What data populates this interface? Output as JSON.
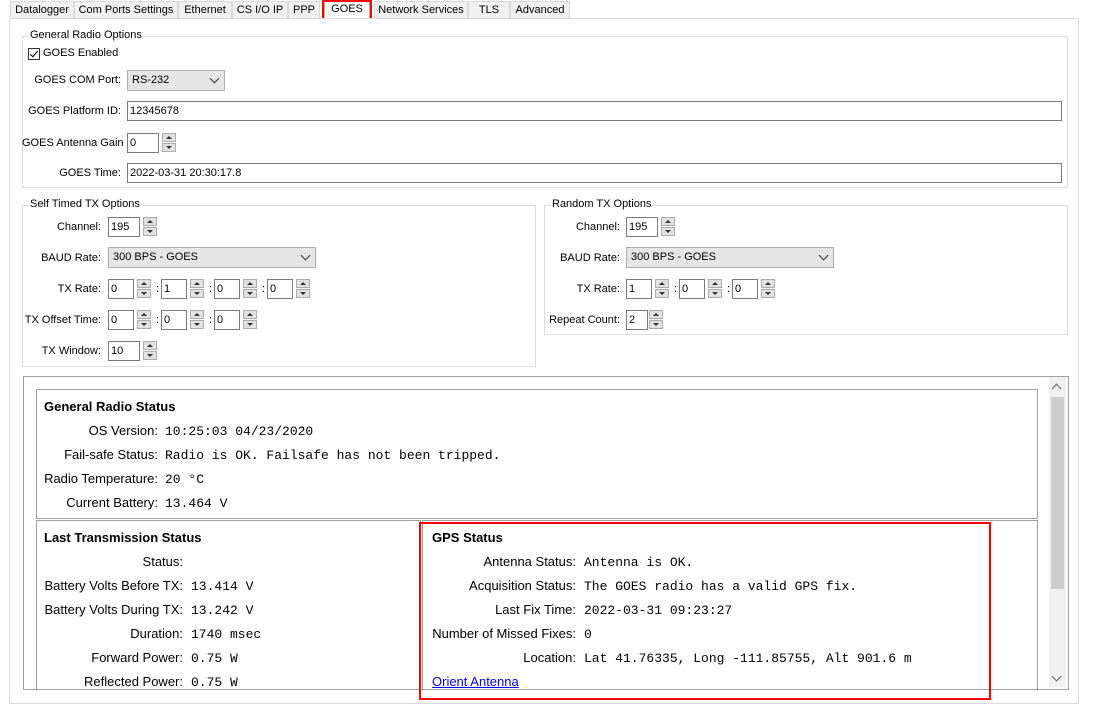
{
  "tabs": [
    {
      "label": "Datalogger"
    },
    {
      "label": "Com Ports Settings"
    },
    {
      "label": "Ethernet"
    },
    {
      "label": "CS I/O IP"
    },
    {
      "label": "PPP"
    },
    {
      "label": "GOES"
    },
    {
      "label": "Network Services"
    },
    {
      "label": "TLS"
    },
    {
      "label": "Advanced"
    }
  ],
  "general_radio_options": {
    "title": "General Radio Options",
    "goes_enabled_label": "GOES Enabled",
    "goes_enabled": true,
    "com_port_label": "GOES COM Port:",
    "com_port_value": "RS-232",
    "platform_id_label": "GOES Platform ID:",
    "platform_id_value": "12345678",
    "antenna_gain_label": "GOES Antenna Gain",
    "antenna_gain_value": "0",
    "time_label": "GOES Time:",
    "time_value": "2022-03-31 20:30:17.8"
  },
  "self_timed": {
    "title": "Self Timed TX Options",
    "channel_label": "Channel:",
    "channel_value": "195",
    "baud_label": "BAUD Rate:",
    "baud_value": "300 BPS - GOES",
    "tx_rate_label": "TX Rate:",
    "tx_rate_values": [
      "0",
      "1",
      "0",
      "0"
    ],
    "tx_offset_label": "TX Offset Time:",
    "tx_offset_values": [
      "0",
      "0",
      "0"
    ],
    "tx_window_label": "TX Window:",
    "tx_window_value": "10"
  },
  "random_tx": {
    "title": "Random TX Options",
    "channel_label": "Channel:",
    "channel_value": "195",
    "baud_label": "BAUD Rate:",
    "baud_value": "300 BPS - GOES",
    "tx_rate_label": "TX Rate:",
    "tx_rate_values": [
      "1",
      "0",
      "0"
    ],
    "repeat_label": "Repeat Count:",
    "repeat_value": "2"
  },
  "colon": ":",
  "general_status": {
    "title": "General Radio Status",
    "rows": [
      {
        "label": "OS Version:",
        "value": "10:25:03 04/23/2020"
      },
      {
        "label": "Fail-safe Status:",
        "value": "Radio is OK. Failsafe has not been tripped."
      },
      {
        "label": "Radio Temperature:",
        "value": "20 °C"
      },
      {
        "label": "Current Battery:",
        "value": "13.464 V"
      }
    ]
  },
  "last_tx_status": {
    "title": "Last Transmission Status",
    "rows": [
      {
        "label": "Status:",
        "value": ""
      },
      {
        "label": "Battery Volts Before TX:",
        "value": "13.414 V"
      },
      {
        "label": "Battery Volts During TX:",
        "value": "13.242 V"
      },
      {
        "label": "Duration:",
        "value": "1740 msec"
      },
      {
        "label": "Forward Power:",
        "value": "0.75 W"
      },
      {
        "label": "Reflected Power:",
        "value": "0.75 W"
      }
    ]
  },
  "gps_status": {
    "title": "GPS Status",
    "rows": [
      {
        "label": "Antenna Status:",
        "value": "Antenna is OK."
      },
      {
        "label": "Acquisition Status:",
        "value": "The GOES radio has a valid GPS fix."
      },
      {
        "label": "Last Fix Time:",
        "value": "2022-03-31 09:23:27"
      },
      {
        "label": "Number of Missed Fixes:",
        "value": "0"
      },
      {
        "label": "Location:",
        "value": "Lat 41.76335, Long -111.85755, Alt 901.6 m"
      }
    ],
    "orient_link": "Orient Antenna"
  },
  "colors": {
    "highlight": "#ff0000",
    "link": "#0000ee"
  }
}
